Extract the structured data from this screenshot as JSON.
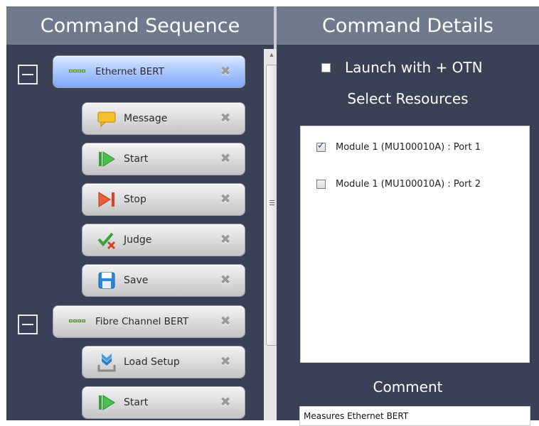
{
  "headers": {
    "left": "Command Sequence",
    "right": "Command Details"
  },
  "sequence": {
    "group1": {
      "label": "Ethernet BERT",
      "children": [
        {
          "label": "Message",
          "icon": "message-icon"
        },
        {
          "label": "Start",
          "icon": "start-icon"
        },
        {
          "label": "Stop",
          "icon": "stop-icon"
        },
        {
          "label": "Judge",
          "icon": "judge-icon"
        },
        {
          "label": "Save",
          "icon": "save-icon"
        }
      ]
    },
    "group2": {
      "label": "Fibre Channel BERT",
      "children": [
        {
          "label": "Load Setup",
          "icon": "load-setup-icon"
        },
        {
          "label": "Start",
          "icon": "start-icon"
        }
      ]
    }
  },
  "details": {
    "launch_label": "Launch with + OTN",
    "launch_checked": false,
    "select_title": "Select Resources",
    "resources": [
      {
        "label": "Module 1 (MU100010A) : Port 1",
        "checked": true
      },
      {
        "label": "Module 1 (MU100010A) : Port 2",
        "checked": false
      }
    ],
    "comment_title": "Comment",
    "comment_value": "Measures Ethernet BERT"
  },
  "colors": {
    "background": "#3a4156",
    "header": "#6f7b8c",
    "selected_row": "#a9c6ff"
  }
}
